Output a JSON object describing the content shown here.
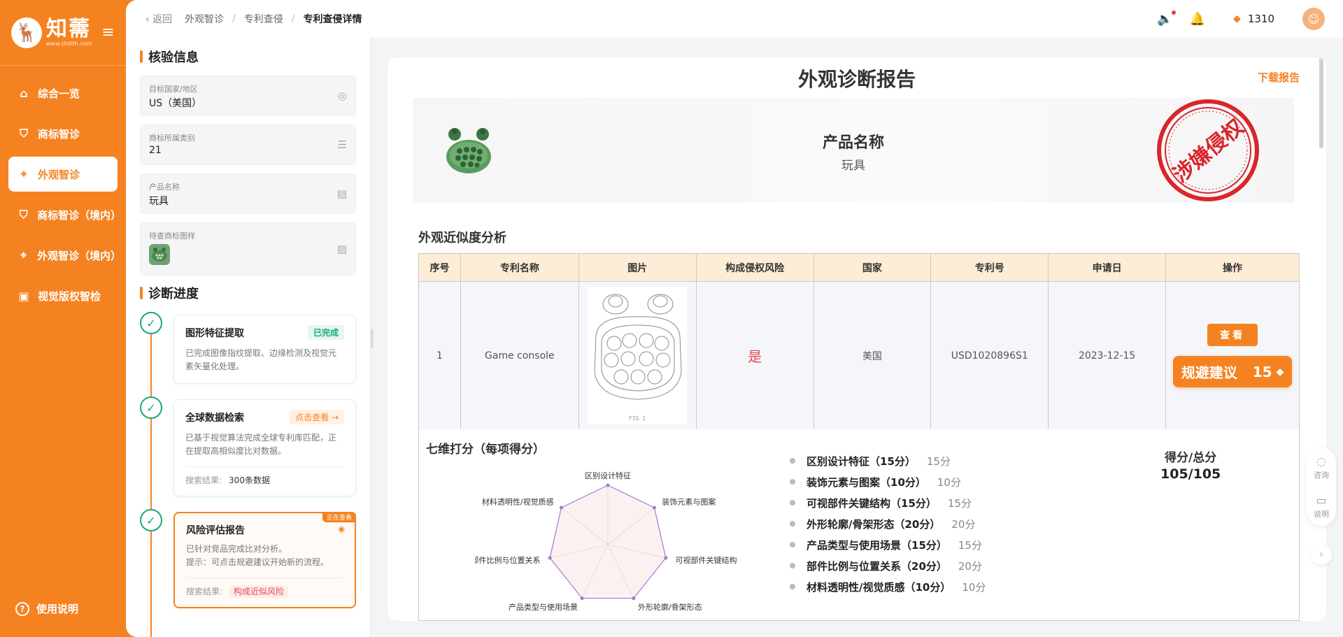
{
  "brand": {
    "name": "知薷",
    "url": "www.zhilith.com"
  },
  "sidebar": {
    "items": [
      {
        "label": "综合一览"
      },
      {
        "label": "商标智诊"
      },
      {
        "label": "外观智诊"
      },
      {
        "label": "商标智诊（境内）"
      },
      {
        "label": "外观智诊（境内）"
      },
      {
        "label": "视觉版权智检"
      }
    ],
    "help_label": "使用说明"
  },
  "topbar": {
    "back_label": "返回",
    "breadcrumb": [
      "外观智诊",
      "专利查侵",
      "专利查侵详情"
    ],
    "coins": "1310"
  },
  "verify": {
    "title": "核验信息",
    "fields": [
      {
        "label": "目标国家/地区",
        "value": "US（美国）"
      },
      {
        "label": "商标所属类别",
        "value": "21"
      },
      {
        "label": "产品名称",
        "value": "玩具"
      },
      {
        "label": "待查商标图样"
      }
    ]
  },
  "progress": {
    "title": "诊断进度",
    "steps": [
      {
        "name": "图形特征提取",
        "badge": "已完成",
        "desc": "已完成图像指纹提取、边缘检测及视觉元素矢量化处理。"
      },
      {
        "name": "全球数据检索",
        "badge": "点击查看 →",
        "desc": "已基于视觉算法完成全球专利库匹配，正在提取高相似度比对数据。",
        "result_label": "搜索结果:",
        "result_value": "300条数据"
      },
      {
        "name": "风险评估报告",
        "ribbon": "正在查看",
        "desc": "已针对竞品完成比对分析。",
        "tip": "提示：可点击规避建议开始新的流程。",
        "result_label": "搜索结果:",
        "result_value": "构成近似风险"
      }
    ]
  },
  "report": {
    "title": "外观诊断报告",
    "download_label": "下载报告",
    "product_label": "产品名称",
    "product_value": "玩具",
    "stamp_text": "涉嫌侵权",
    "similarity_title": "外观近似度分析",
    "table": {
      "headers": [
        "序号",
        "专利名称",
        "图片",
        "构成侵权风险",
        "国家",
        "专利号",
        "申请日",
        "操作"
      ],
      "row": {
        "index": "1",
        "name": "Game console",
        "fig_label": "FIG 1",
        "risk": "是",
        "country": "美国",
        "patent_no": "USD1020896S1",
        "date": "2023-12-15",
        "view_label": "查看",
        "avoid_label": "规避建议",
        "avoid_cost": "15"
      }
    },
    "score": {
      "title": "七维打分（每项得分）",
      "dimensions": [
        {
          "label": "区别设计特征（15分）",
          "score": "15分",
          "radar_label": "区别设计特征"
        },
        {
          "label": "装饰元素与图案（10分）",
          "score": "10分",
          "radar_label": "装饰元素与图案"
        },
        {
          "label": "可视部件关键结构（15分）",
          "score": "15分",
          "radar_label": "可视部件关键结构"
        },
        {
          "label": "外形轮廓/骨架形态（20分）",
          "score": "20分",
          "radar_label": "外形轮廓/骨架形态"
        },
        {
          "label": "产品类型与使用场景（15分）",
          "score": "15分",
          "radar_label": "产品类型与使用场景"
        },
        {
          "label": "部件比例与位置关系（20分）",
          "score": "20分",
          "radar_label": "部件比例与位置关系"
        },
        {
          "label": "材料透明性/视觉质感（10分）",
          "score": "10分",
          "radar_label": "材料透明性/视觉质感"
        }
      ],
      "total_label": "得分/总分",
      "total_value": "105/105"
    }
  },
  "float": {
    "consult": "咨询",
    "explain": "说明"
  },
  "colors": {
    "brand": "#f58220",
    "success": "#19a974",
    "danger": "#e5484d"
  }
}
